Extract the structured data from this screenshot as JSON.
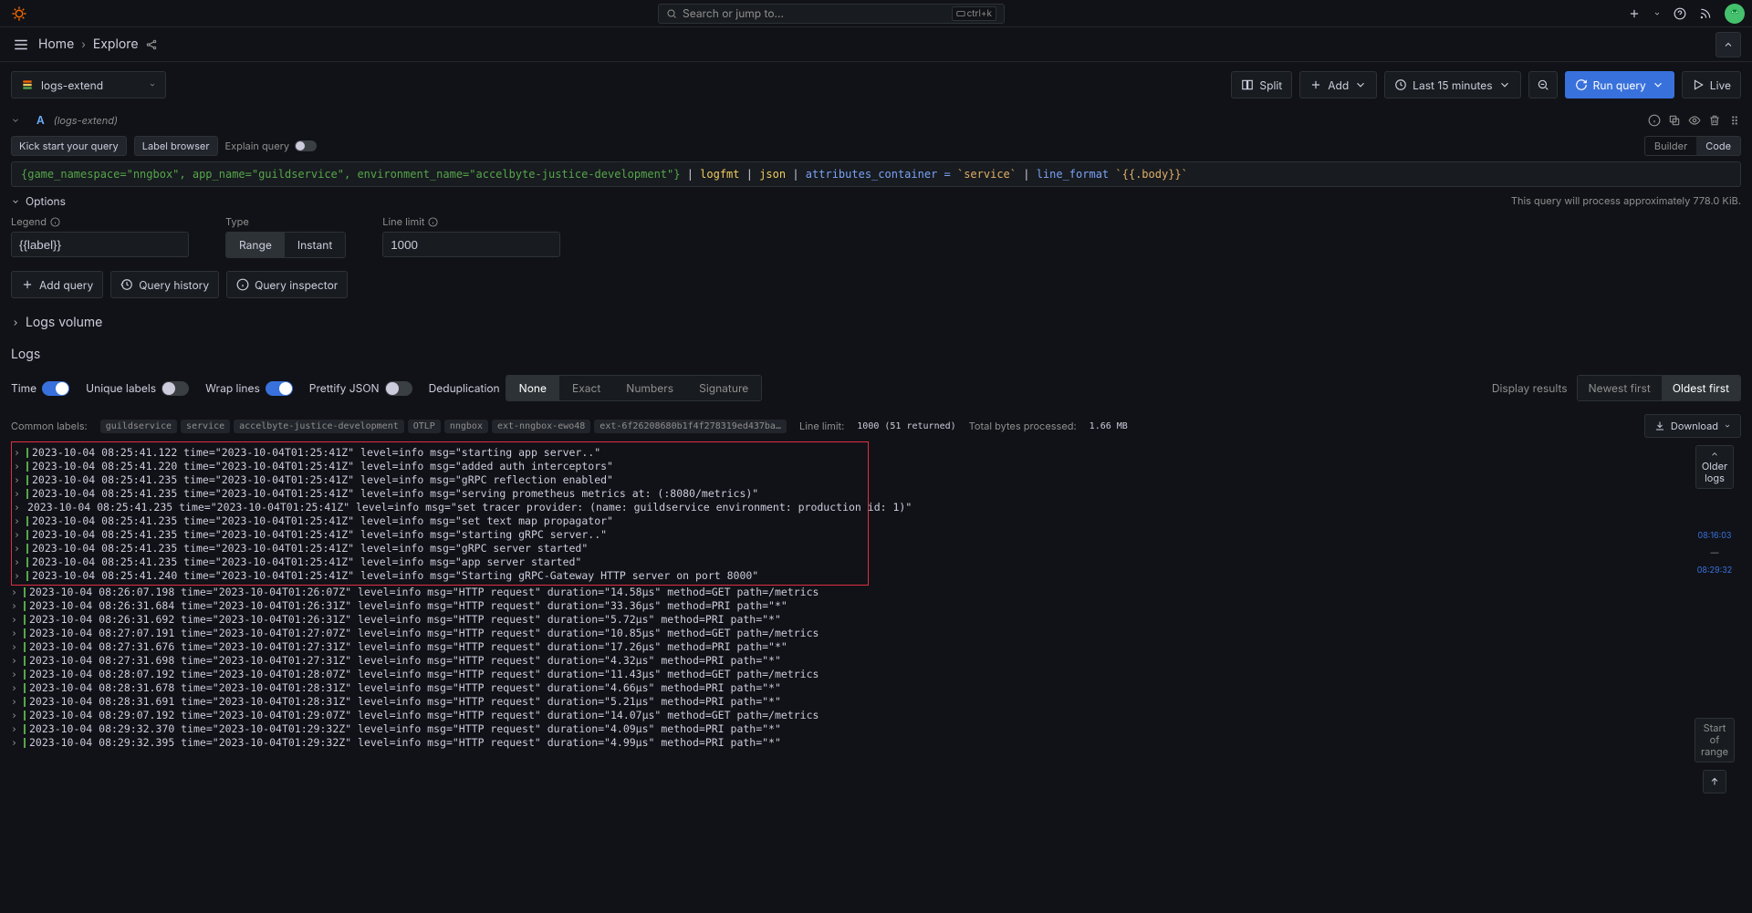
{
  "search": {
    "placeholder": "Search or jump to...",
    "kbd": "ctrl+k"
  },
  "breadcrumb": {
    "home": "Home",
    "explore": "Explore"
  },
  "datasource": {
    "name": "logs-extend"
  },
  "toolbar": {
    "split": "Split",
    "add": "Add",
    "time": "Last 15 minutes",
    "run": "Run query",
    "live": "Live"
  },
  "query": {
    "letter": "A",
    "ds": "(logs-extend)",
    "kick": "Kick start your query",
    "label_browser": "Label browser",
    "explain": "Explain query",
    "tabs": {
      "builder": "Builder",
      "code": "Code"
    },
    "code": {
      "labels": "{game_namespace=\"nngbox\", app_name=\"guildservice\", environment_name=\"accelbyte-justice-development\"}",
      "p1": " | ",
      "logfmt": "logfmt",
      "p2": " | ",
      "json": "json",
      "p3": " | ",
      "attr": "attributes_container = ",
      "attr_val": "`service`",
      "p4": " | ",
      "lf": "line_format ",
      "lf_val": "`{{.body}}`"
    },
    "options": {
      "title": "Options",
      "legend_label": "Legend",
      "legend_value": "{{label}}",
      "type_label": "Type",
      "type_range": "Range",
      "type_instant": "Instant",
      "limit_label": "Line limit",
      "limit_value": "1000",
      "info": "This query will process approximately 778.0 KiB."
    }
  },
  "actions": {
    "add_query": "Add query",
    "history": "Query history",
    "inspector": "Query inspector"
  },
  "logs_volume": "Logs volume",
  "logs_title": "Logs",
  "logs_toolbar": {
    "time": "Time",
    "unique": "Unique labels",
    "wrap": "Wrap lines",
    "pretty": "Prettify JSON",
    "dedup": "Deduplication",
    "dedup_opts": [
      "None",
      "Exact",
      "Numbers",
      "Signature"
    ],
    "display": "Display results",
    "newest": "Newest first",
    "oldest": "Oldest first"
  },
  "meta": {
    "common_label": "Common labels:",
    "labels": [
      "guildservice",
      "service",
      "accelbyte-justice-development",
      "OTLP",
      "nngbox",
      "ext-nngbox-ewo48",
      "ext-6f26208680b1f4f278319ed437ba…"
    ],
    "line_limit_label": "Line limit:",
    "line_limit_value": "1000 (51 returned)",
    "bytes_label": "Total bytes processed:",
    "bytes_value": "1.66 MB",
    "download": "Download"
  },
  "rail": {
    "older1": "Older",
    "older2": "logs",
    "ts1": "08:16:03",
    "dash": "—",
    "ts2": "08:29:32",
    "start1": "Start",
    "start2": "of",
    "start3": "range"
  },
  "log_lines_boxed": [
    "2023-10-04 08:25:41.122 time=\"2023-10-04T01:25:41Z\" level=info msg=\"starting app server..\"",
    "2023-10-04 08:25:41.220 time=\"2023-10-04T01:25:41Z\" level=info msg=\"added auth interceptors\"",
    "2023-10-04 08:25:41.235 time=\"2023-10-04T01:25:41Z\" level=info msg=\"gRPC reflection enabled\"",
    "2023-10-04 08:25:41.235 time=\"2023-10-04T01:25:41Z\" level=info msg=\"serving prometheus metrics at: (:8080/metrics)\"",
    "2023-10-04 08:25:41.235 time=\"2023-10-04T01:25:41Z\" level=info msg=\"set tracer provider: (name: guildservice environment: production id: 1)\"",
    "2023-10-04 08:25:41.235 time=\"2023-10-04T01:25:41Z\" level=info msg=\"set text map propagator\"",
    "2023-10-04 08:25:41.235 time=\"2023-10-04T01:25:41Z\" level=info msg=\"starting gRPC server..\"",
    "2023-10-04 08:25:41.235 time=\"2023-10-04T01:25:41Z\" level=info msg=\"gRPC server started\"",
    "2023-10-04 08:25:41.235 time=\"2023-10-04T01:25:41Z\" level=info msg=\"app server started\"",
    "2023-10-04 08:25:41.240 time=\"2023-10-04T01:25:41Z\" level=info msg=\"Starting gRPC-Gateway HTTP server on port 8000\""
  ],
  "log_lines_rest": [
    "2023-10-04 08:26:07.198 time=\"2023-10-04T01:26:07Z\" level=info msg=\"HTTP request\" duration=\"14.58µs\" method=GET path=/metrics",
    "2023-10-04 08:26:31.684 time=\"2023-10-04T01:26:31Z\" level=info msg=\"HTTP request\" duration=\"33.36µs\" method=PRI path=\"*\"",
    "2023-10-04 08:26:31.692 time=\"2023-10-04T01:26:31Z\" level=info msg=\"HTTP request\" duration=\"5.72µs\" method=PRI path=\"*\"",
    "2023-10-04 08:27:07.191 time=\"2023-10-04T01:27:07Z\" level=info msg=\"HTTP request\" duration=\"10.85µs\" method=GET path=/metrics",
    "2023-10-04 08:27:31.676 time=\"2023-10-04T01:27:31Z\" level=info msg=\"HTTP request\" duration=\"17.26µs\" method=PRI path=\"*\"",
    "2023-10-04 08:27:31.698 time=\"2023-10-04T01:27:31Z\" level=info msg=\"HTTP request\" duration=\"4.32µs\" method=PRI path=\"*\"",
    "2023-10-04 08:28:07.192 time=\"2023-10-04T01:28:07Z\" level=info msg=\"HTTP request\" duration=\"11.43µs\" method=GET path=/metrics",
    "2023-10-04 08:28:31.678 time=\"2023-10-04T01:28:31Z\" level=info msg=\"HTTP request\" duration=\"4.66µs\" method=PRI path=\"*\"",
    "2023-10-04 08:28:31.691 time=\"2023-10-04T01:28:31Z\" level=info msg=\"HTTP request\" duration=\"5.21µs\" method=PRI path=\"*\"",
    "2023-10-04 08:29:07.192 time=\"2023-10-04T01:29:07Z\" level=info msg=\"HTTP request\" duration=\"14.07µs\" method=GET path=/metrics",
    "2023-10-04 08:29:32.370 time=\"2023-10-04T01:29:32Z\" level=info msg=\"HTTP request\" duration=\"4.09µs\" method=PRI path=\"*\"",
    "2023-10-04 08:29:32.395 time=\"2023-10-04T01:29:32Z\" level=info msg=\"HTTP request\" duration=\"4.99µs\" method=PRI path=\"*\""
  ]
}
